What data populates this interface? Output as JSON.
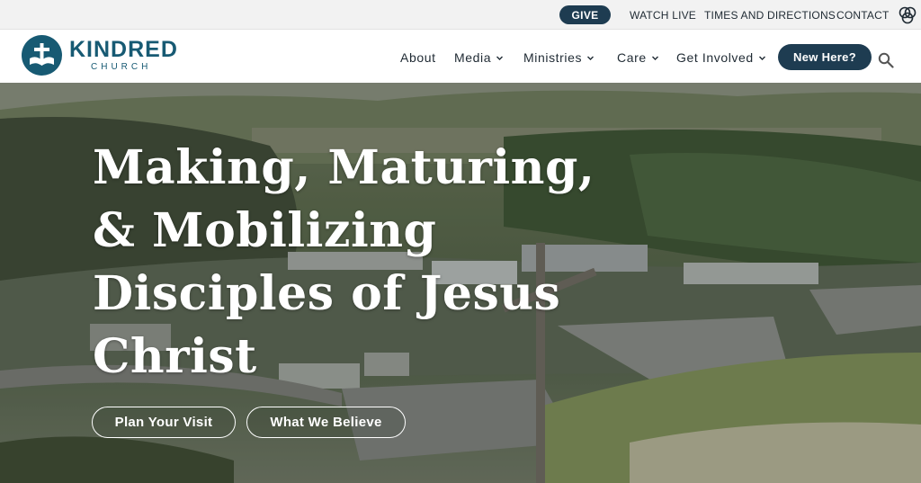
{
  "utility_bar": {
    "give_label": "GIVE",
    "links": [
      "WATCH LIVE",
      "TIMES AND DIRECTIONS",
      "CONTACT"
    ],
    "icon": "circles-icon"
  },
  "logo": {
    "word": "KINDRED",
    "sub": "CHURCH",
    "emblem": "cross-book-icon"
  },
  "nav": {
    "items": [
      {
        "label": "About",
        "dropdown": false
      },
      {
        "label": "Media",
        "dropdown": true
      },
      {
        "label": "Ministries",
        "dropdown": true
      },
      {
        "label": "Care",
        "dropdown": true
      },
      {
        "label": "Get Involved",
        "dropdown": true
      }
    ],
    "cta_label": "New Here?",
    "search_icon": "search-icon"
  },
  "hero": {
    "title": "Making, Maturing, & Mobilizing Disciples of Jesus Christ",
    "buttons": [
      "Plan Your Visit",
      "What We Believe"
    ]
  },
  "colors": {
    "brand": "#1e3c51",
    "logo": "#175a73",
    "utility_bg": "#f2f2f2"
  }
}
